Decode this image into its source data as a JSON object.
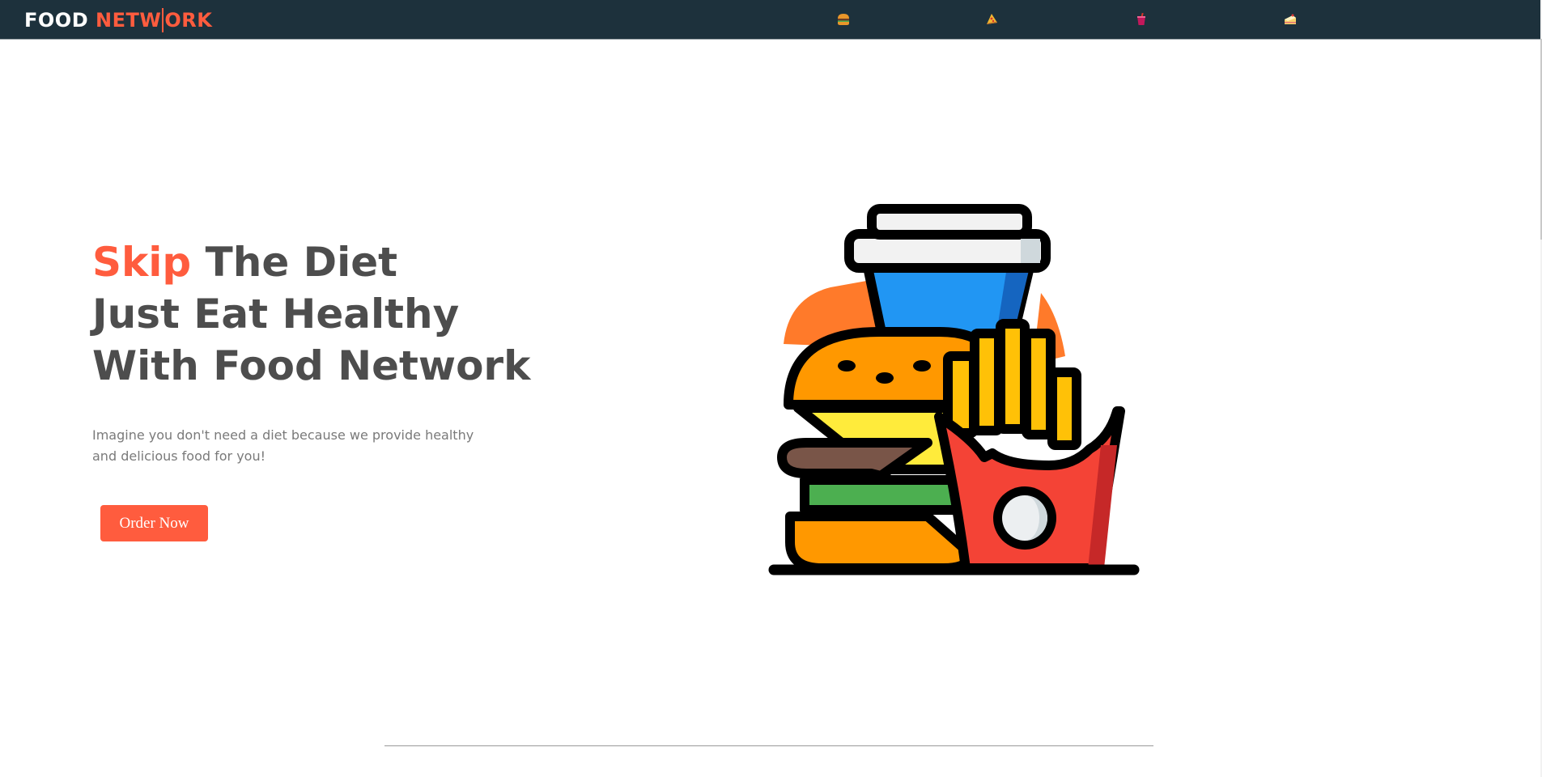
{
  "brand": {
    "part1": "FOOD",
    "part2_a": "NETW",
    "part2_b": "ORK"
  },
  "nav": {
    "icons": [
      {
        "name": "burger-icon"
      },
      {
        "name": "pizza-icon"
      },
      {
        "name": "drink-icon"
      },
      {
        "name": "cake-icon"
      }
    ]
  },
  "hero": {
    "title_accent": "Skip",
    "title_line1_rest": " The Diet",
    "title_line2": "Just Eat Healthy",
    "title_line3": "With Food Network",
    "text_line1": "Imagine you don't need a diet because we provide healthy",
    "text_line2": "and delicious food for you!",
    "button_label": "Order Now",
    "illustration": "fast-food-illustration"
  },
  "colors": {
    "accent": "#ff5c3e",
    "navbar": "#1d313c",
    "heading": "#4d4d4d",
    "body_text": "#7a7a7a"
  }
}
